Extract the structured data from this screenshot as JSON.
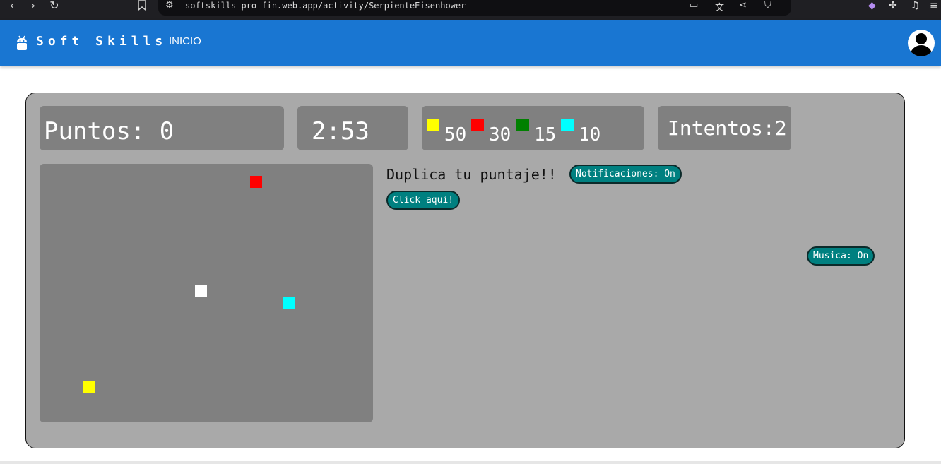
{
  "browser": {
    "url": "softskills-pro-fin.web.app/activity/SerpienteEisenhower",
    "nav_back": "‹",
    "nav_forward": "›",
    "nav_reload": "↻",
    "bookmark_icon": "bookmark-icon",
    "site_info_icon": "tune-icon",
    "toolbar_icons": [
      "install-icon",
      "translate-icon",
      "share-icon",
      "brave-shield-icon",
      "brave-rewards-icon",
      "extensions-icon",
      "media-icon"
    ]
  },
  "header": {
    "brand": "Soft Skills",
    "nav": [
      {
        "label": "INICIO"
      }
    ],
    "color": "#1976d2",
    "avatar_icon": "account-circle-icon"
  },
  "game": {
    "score_label": "Puntos: 0",
    "timer": "2:53",
    "attempts_label": "Intentos:2",
    "legend": [
      {
        "color": "#ffff00",
        "value": "50"
      },
      {
        "color": "#ff0000",
        "value": "30"
      },
      {
        "color": "#008000",
        "value": "15"
      },
      {
        "color": "#00ffff",
        "value": "10"
      }
    ],
    "board_items": [
      {
        "color": "#ff0000"
      },
      {
        "color": "#ffffff"
      },
      {
        "color": "#00ffff"
      },
      {
        "color": "#ffff00"
      }
    ],
    "promo_text": "Duplica tu puntaje!!",
    "notifications_button": "Notificaciones: On",
    "click_button": "Click aqui!",
    "music_button": "Musica: On",
    "pill_color": "#008080",
    "panel_color": "#a9a9a9",
    "board_color": "#808080"
  }
}
